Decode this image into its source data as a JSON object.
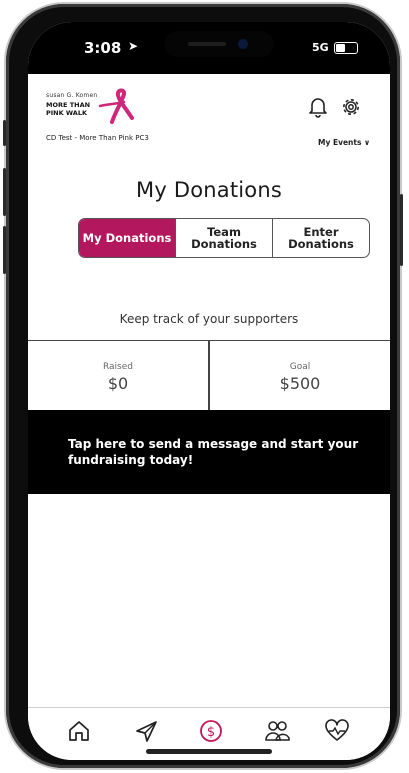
{
  "status_bar": {
    "time": "3:08",
    "signal": "5G"
  },
  "header": {
    "logo": {
      "line1": "susan G. Komen",
      "line2": "MORE THAN",
      "line3": "PINK WALK"
    },
    "event_subtitle": "CD Test - More Than Pink PC3",
    "events_menu_label": "My Events ∨"
  },
  "page": {
    "title": "My Donations",
    "tabs": [
      {
        "label": "My Donations",
        "active": true
      },
      {
        "label": "Team Donations",
        "active": false
      },
      {
        "label": "Enter Donations",
        "active": false
      }
    ],
    "tagline": "Keep track of your supporters"
  },
  "stats": {
    "raised": {
      "label": "Raised",
      "value": "$0"
    },
    "goal": {
      "label": "Goal",
      "value": "$500"
    }
  },
  "cta": {
    "text": "Tap here to send a message and start your fundraising today!"
  },
  "bottom_nav": {
    "items": [
      {
        "icon": "home-icon"
      },
      {
        "icon": "send-icon"
      },
      {
        "icon": "donations-icon",
        "active": true
      },
      {
        "icon": "team-icon"
      },
      {
        "icon": "heart-pulse-icon"
      }
    ]
  },
  "colors": {
    "accent": "#b3185f",
    "brand_pink": "#d0277a",
    "banner": "#000000"
  }
}
